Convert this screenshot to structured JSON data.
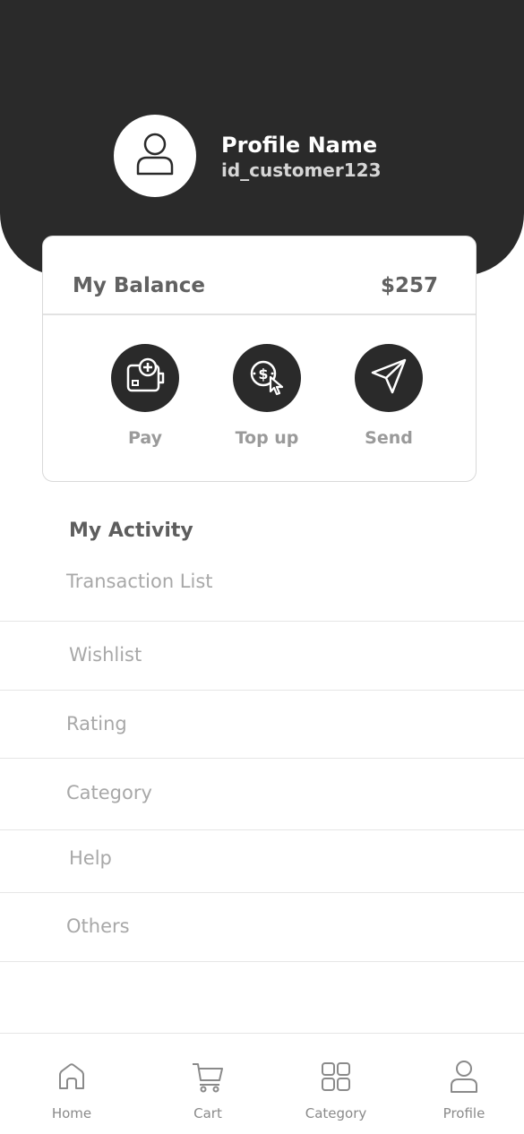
{
  "profile": {
    "name": "Profile Name",
    "id": "id_customer123",
    "avatar_icon": "user-icon"
  },
  "balance": {
    "title": "My Balance",
    "amount": "$257"
  },
  "actions": [
    {
      "label": "Pay",
      "icon": "wallet-add-icon"
    },
    {
      "label": "Top up",
      "icon": "coin-cursor-icon"
    },
    {
      "label": "Send",
      "icon": "send-icon"
    }
  ],
  "activity": {
    "title": "My Activity",
    "items": [
      {
        "label": "Transaction List"
      },
      {
        "label": "Wishlist"
      },
      {
        "label": "Rating"
      },
      {
        "label": "Category"
      },
      {
        "label": "Help"
      },
      {
        "label": "Others"
      }
    ]
  },
  "nav": [
    {
      "label": "Home",
      "icon": "home-icon"
    },
    {
      "label": "Cart",
      "icon": "cart-icon"
    },
    {
      "label": "Category",
      "icon": "grid-icon"
    },
    {
      "label": "Profile",
      "icon": "user-icon"
    }
  ],
  "colors": {
    "dark": "#2a2a2a",
    "muted_text": "#a8a8a8",
    "heading_text": "#616161"
  }
}
